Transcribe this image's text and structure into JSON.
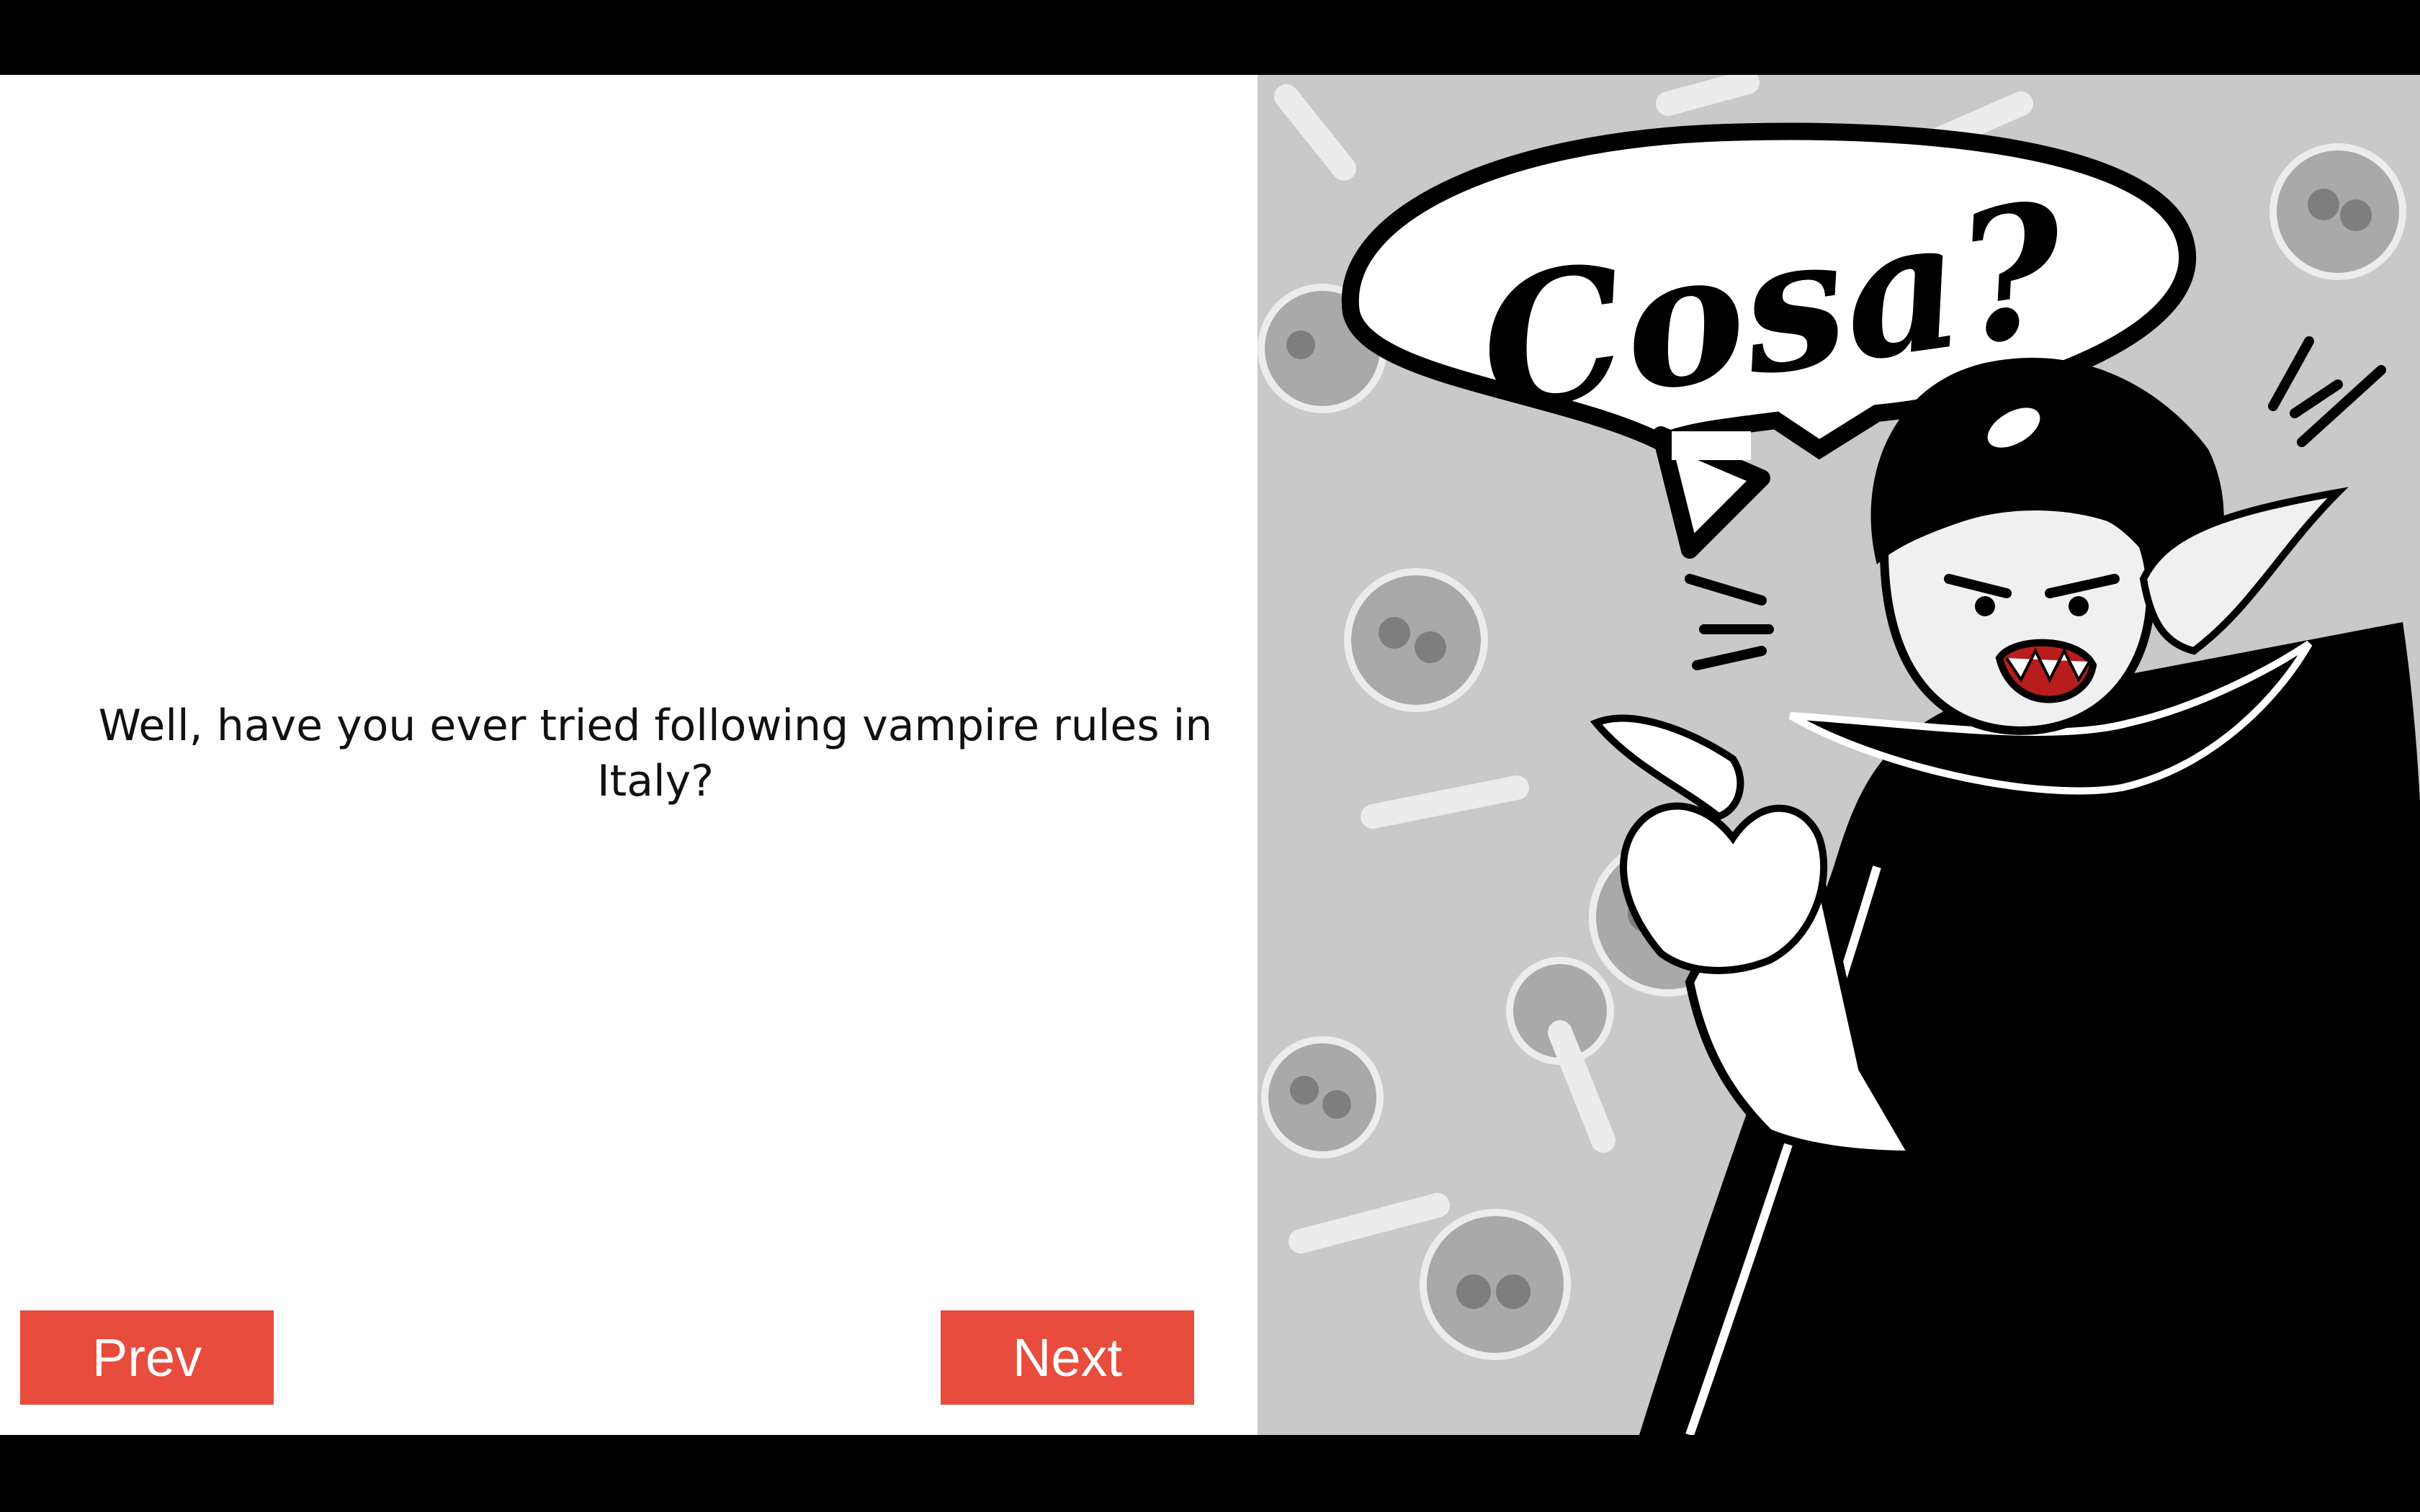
{
  "story": {
    "text": "Well, have you ever tried following vampire rules in Italy?"
  },
  "navigation": {
    "prev_label": "Prev",
    "next_label": "Next"
  },
  "illustration": {
    "speech_bubble_text": "Cosa?",
    "character": "vampire",
    "background_pattern": "skulls-and-bones"
  },
  "colors": {
    "button": "#e74c3c",
    "panel_bg": "#fefefe",
    "illustration_bg": "#c9c9c9"
  }
}
